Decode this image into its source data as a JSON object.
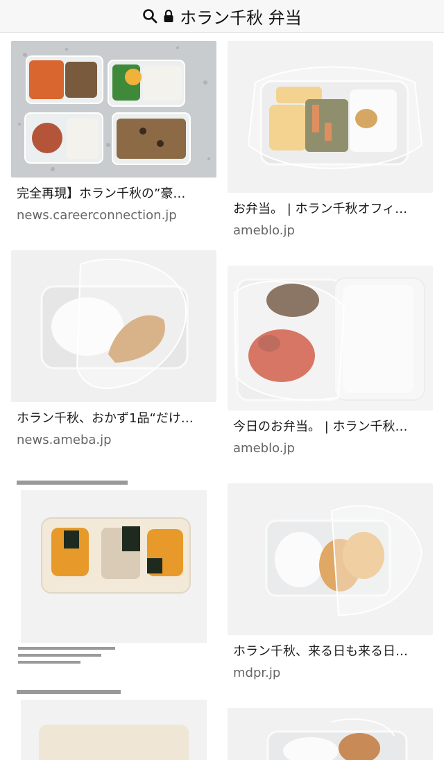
{
  "search": {
    "query": "ホラン千秋 弁当",
    "search_icon": "search-icon",
    "lock_icon": "lock-icon"
  },
  "results": {
    "left": [
      {
        "title": "完全再現】ホラン千秋の”豪…",
        "site": "news.careerconnection.jp"
      },
      {
        "title": "ホラン千秋、おかず1品“だけ…",
        "site": "news.ameba.jp"
      },
      {
        "title": "",
        "site": ""
      }
    ],
    "right": [
      {
        "title": "お弁当。 | ホラン千秋オフィ…",
        "site": "ameblo.jp"
      },
      {
        "title": "今日のお弁当。 | ホラン千秋…",
        "site": "ameblo.jp"
      },
      {
        "title": "ホラン千秋、来る日も来る日…",
        "site": "mdpr.jp"
      },
      {
        "title": "",
        "site": ""
      }
    ]
  },
  "colors": {
    "rice": "#f4f2ec",
    "container": "#e9ecee",
    "accent": "#c46a2a"
  }
}
